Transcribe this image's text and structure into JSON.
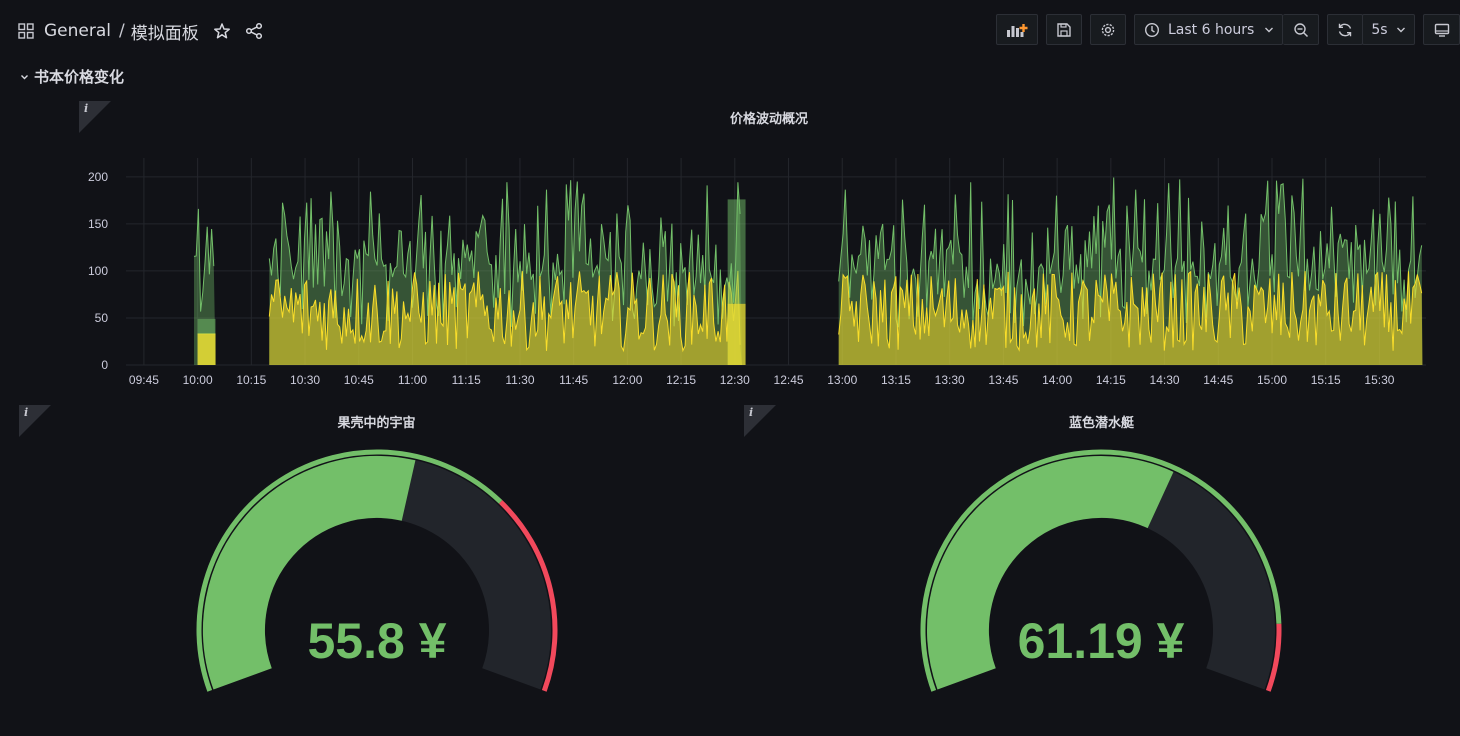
{
  "breadcrumb": {
    "folder": "General",
    "separator": "/",
    "dashboard": "模拟面板"
  },
  "toolbar": {
    "time_range": "Last 6 hours",
    "refresh_interval": "5s",
    "icons": [
      "add-panel-icon",
      "save-icon",
      "settings-icon",
      "clock-icon",
      "zoom-out-icon",
      "refresh-icon",
      "tv-mode-icon"
    ]
  },
  "row": {
    "title": "书本价格变化"
  },
  "timeseries": {
    "title": "价格波动概况",
    "info_symbol": "i"
  },
  "gauges": [
    {
      "title": "果壳中的宇宙",
      "value": "55.8 ¥",
      "numeric": 55.8,
      "min": 0,
      "max": 100,
      "threshold": 70,
      "info_symbol": "i"
    },
    {
      "title": "蓝色潜水艇",
      "value": "61.19 ¥",
      "numeric": 61.19,
      "min": 0,
      "max": 100,
      "threshold": 90,
      "info_symbol": "i"
    }
  ],
  "colors": {
    "background": "#111217",
    "series_green": "#73bf69",
    "series_yellow": "#fade2a",
    "threshold_red": "#f2495c",
    "gauge_track": "#22252b"
  },
  "chart_data": {
    "type": "area",
    "title": "价格波动概况",
    "y_ticks": [
      0,
      50,
      100,
      150,
      200
    ],
    "ylim": [
      0,
      220
    ],
    "x_ticks": [
      "09:45",
      "10:00",
      "10:15",
      "10:30",
      "10:45",
      "11:00",
      "11:15",
      "11:30",
      "11:45",
      "12:00",
      "12:15",
      "12:30",
      "12:45",
      "13:00",
      "13:15",
      "13:30",
      "13:45",
      "14:00",
      "14:15",
      "14:30",
      "14:45",
      "15:00",
      "15:15",
      "15:30"
    ],
    "grid": true,
    "series": [
      {
        "color": "#73bf69",
        "max_value": 200,
        "segments": [
          [
            "09:59",
            "10:05"
          ],
          [
            "10:20",
            "12:32"
          ],
          [
            "12:59",
            "15:42"
          ]
        ]
      },
      {
        "color": "#fade2a",
        "max_value": 100,
        "segments": [
          [
            "10:00",
            "10:05"
          ],
          [
            "10:20",
            "12:32"
          ],
          [
            "12:59",
            "15:42"
          ]
        ]
      }
    ],
    "bars": [
      {
        "start": "10:00",
        "end": "10:05",
        "green": 49,
        "yellow": 33
      },
      {
        "start": "12:28",
        "end": "12:33",
        "green": 176,
        "yellow": 65
      }
    ]
  }
}
